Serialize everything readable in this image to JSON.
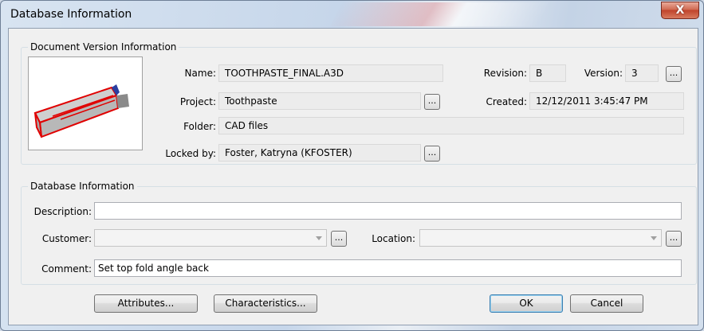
{
  "window": {
    "title": "Database Information",
    "close_label": "X"
  },
  "doc_version": {
    "group_label": "Document Version Information",
    "name_label": "Name:",
    "name_value": "TOOTHPASTE_FINAL.A3D",
    "project_label": "Project:",
    "project_value": "Toothpaste",
    "folder_label": "Folder:",
    "folder_value": "CAD files",
    "locked_label": "Locked by:",
    "locked_value": "Foster, Katryna (KFOSTER)",
    "revision_label": "Revision:",
    "revision_value": "B",
    "version_label": "Version:",
    "version_value": "3",
    "created_label": "Created:",
    "created_value": "12/12/2011 3:45:47 PM",
    "browse_label": "..."
  },
  "db_info": {
    "group_label": "Database Information",
    "description_label": "Description:",
    "description_value": "",
    "customer_label": "Customer:",
    "customer_value": "",
    "location_label": "Location:",
    "location_value": "",
    "comment_label": "Comment:",
    "comment_value": "Set top fold angle back",
    "browse_label": "..."
  },
  "buttons": {
    "attributes": "Attributes...",
    "characteristics": "Characteristics...",
    "ok": "OK",
    "cancel": "Cancel"
  },
  "colors": {
    "accent": "#3c7fb1",
    "thumbnail_outline": "#e00000",
    "close": "#c0432b"
  }
}
